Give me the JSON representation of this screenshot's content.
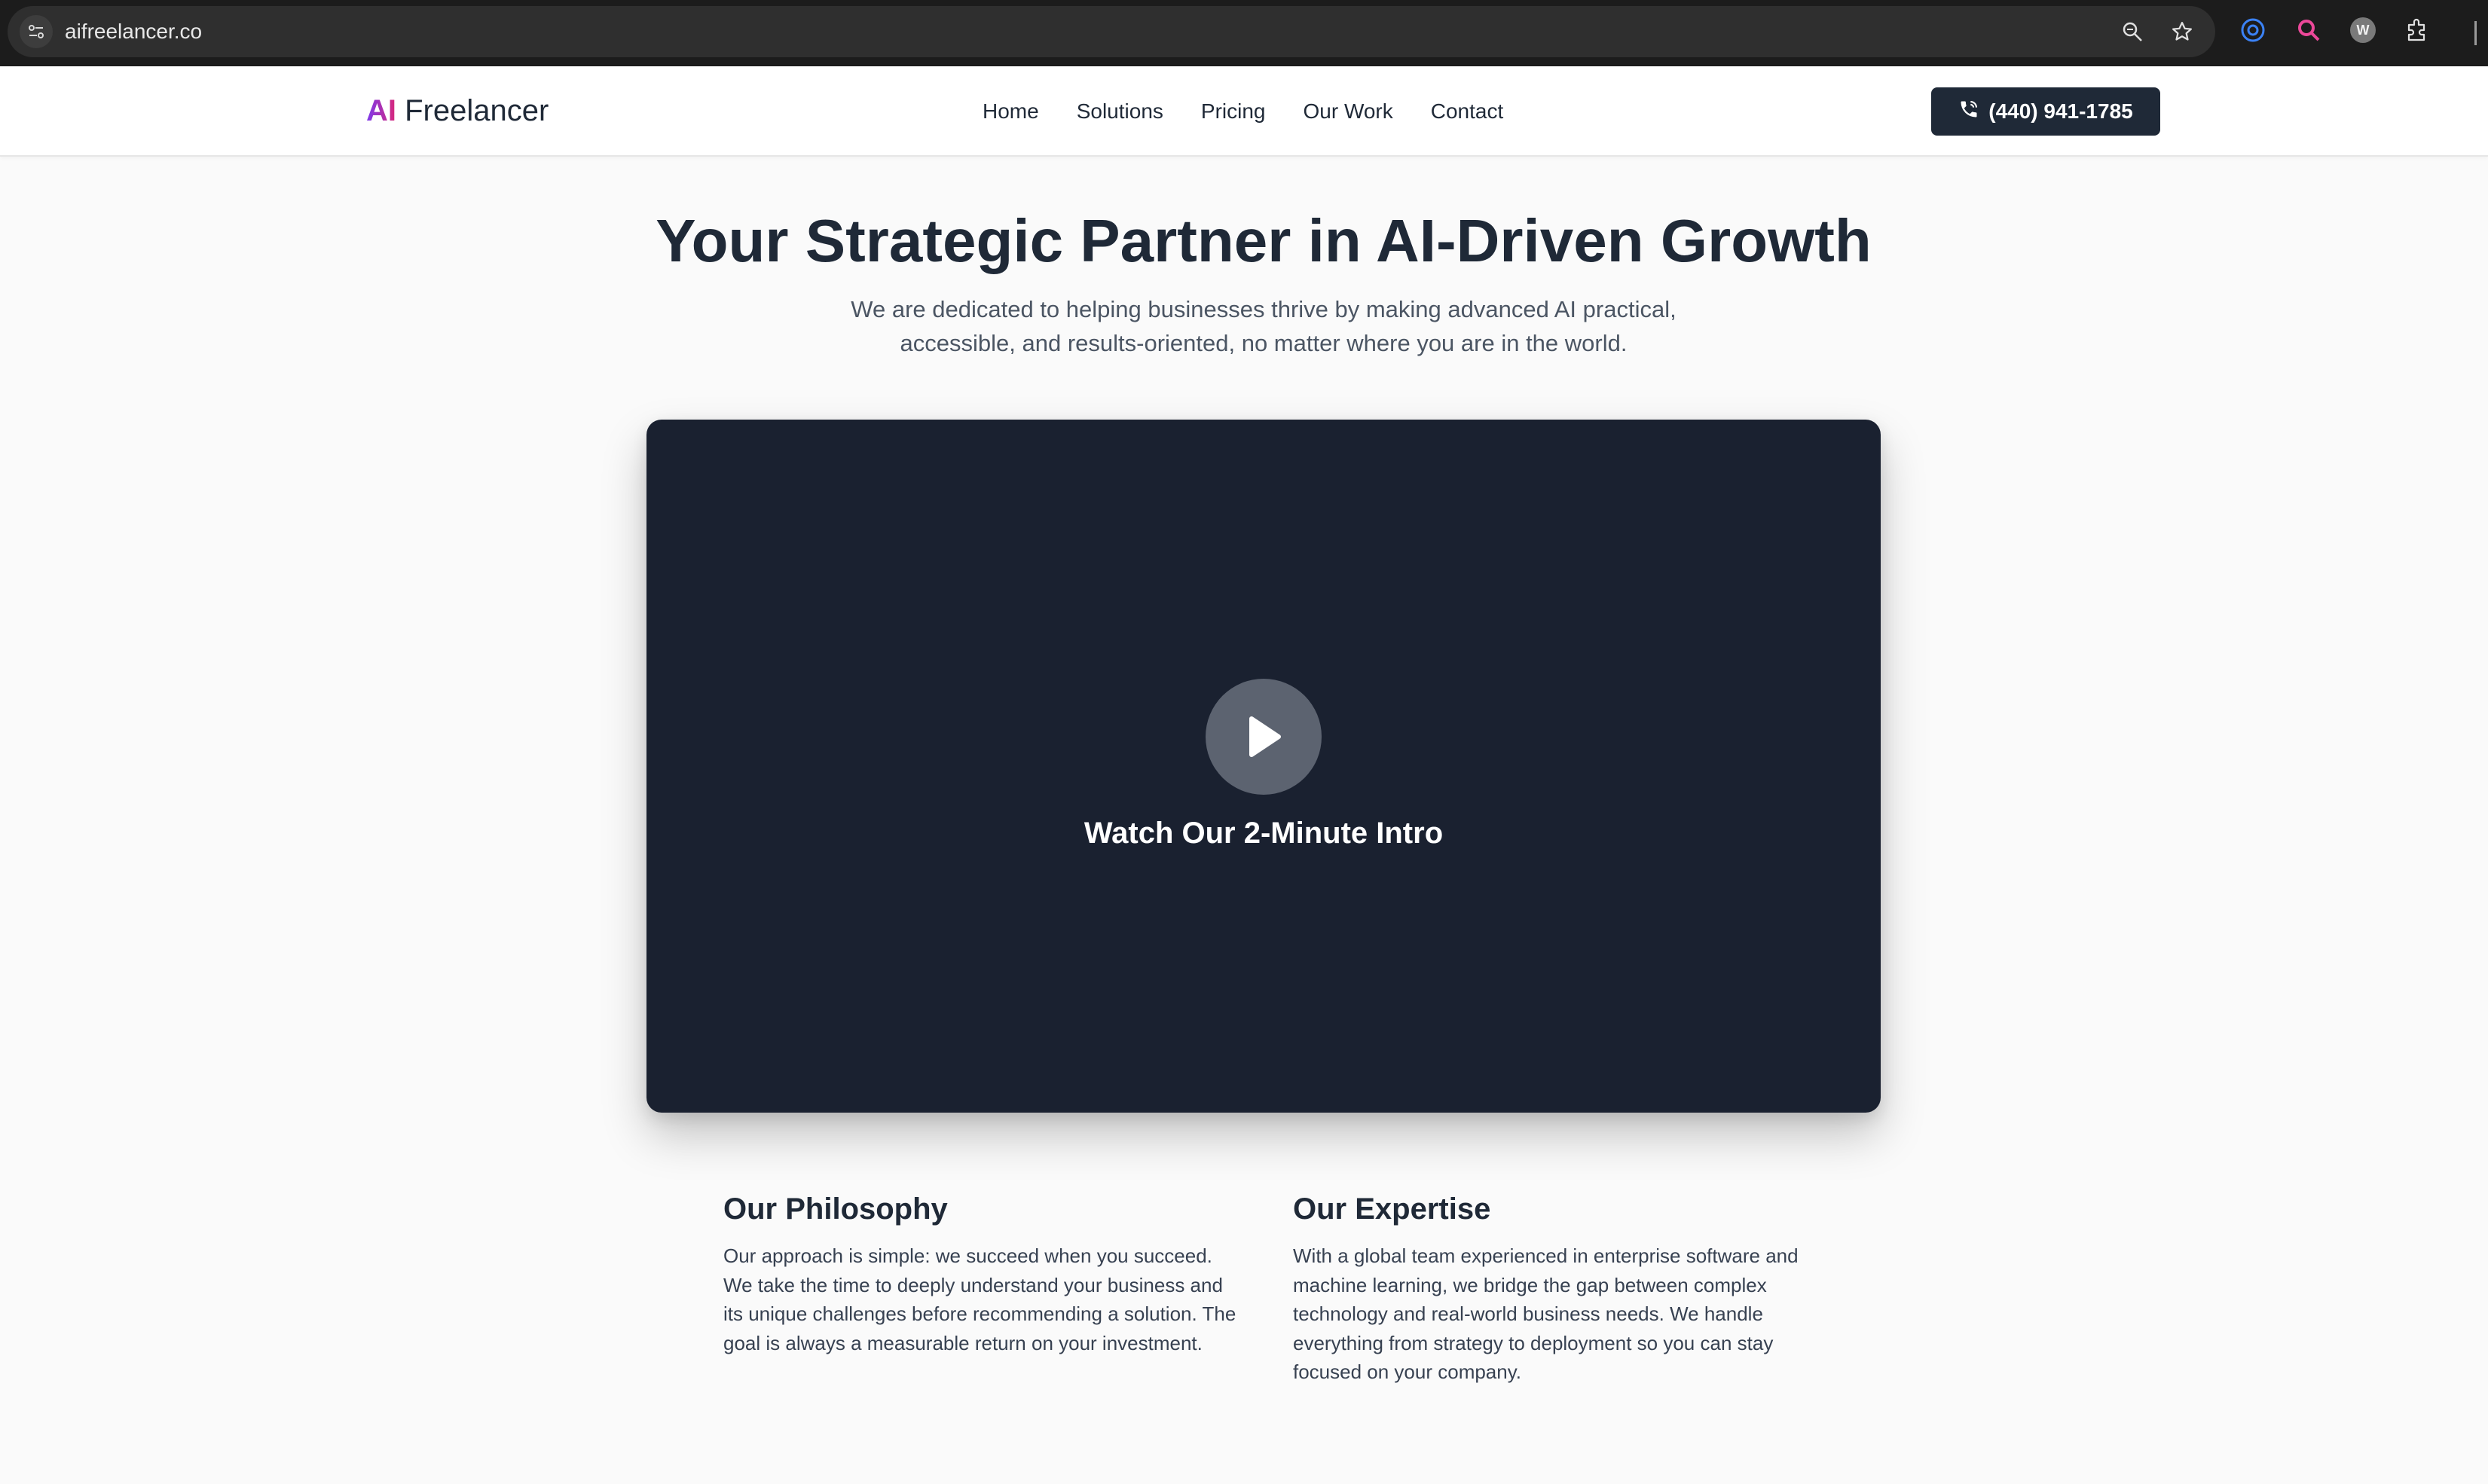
{
  "browser": {
    "url": "aifreelancer.co"
  },
  "header": {
    "logo_ai": "AI",
    "logo_rest": " Freelancer",
    "nav": [
      "Home",
      "Solutions",
      "Pricing",
      "Our Work",
      "Contact"
    ],
    "phone": "(440) 941-1785"
  },
  "hero": {
    "title": "Your Strategic Partner in AI-Driven Growth",
    "subtitle": "We are dedicated to helping businesses thrive by making advanced AI practical, accessible, and results-oriented, no matter where you are in the world."
  },
  "video": {
    "caption": "Watch Our 2-Minute Intro"
  },
  "columns": [
    {
      "title": "Our Philosophy",
      "text": "Our approach is simple: we succeed when you succeed. We take the time to deeply understand your business and its unique challenges before recommending a solution. The goal is always a measurable return on your investment."
    },
    {
      "title": "Our Expertise",
      "text": "With a global team experienced in enterprise software and machine learning, we bridge the gap between complex technology and real-world business needs. We handle everything from strategy to deployment so you can stay focused on your company."
    }
  ],
  "colors": {
    "dark": "#1f2937",
    "video_bg": "#1a2130",
    "logo_gradient_start": "#7c3aed",
    "logo_gradient_end": "#db2777"
  }
}
